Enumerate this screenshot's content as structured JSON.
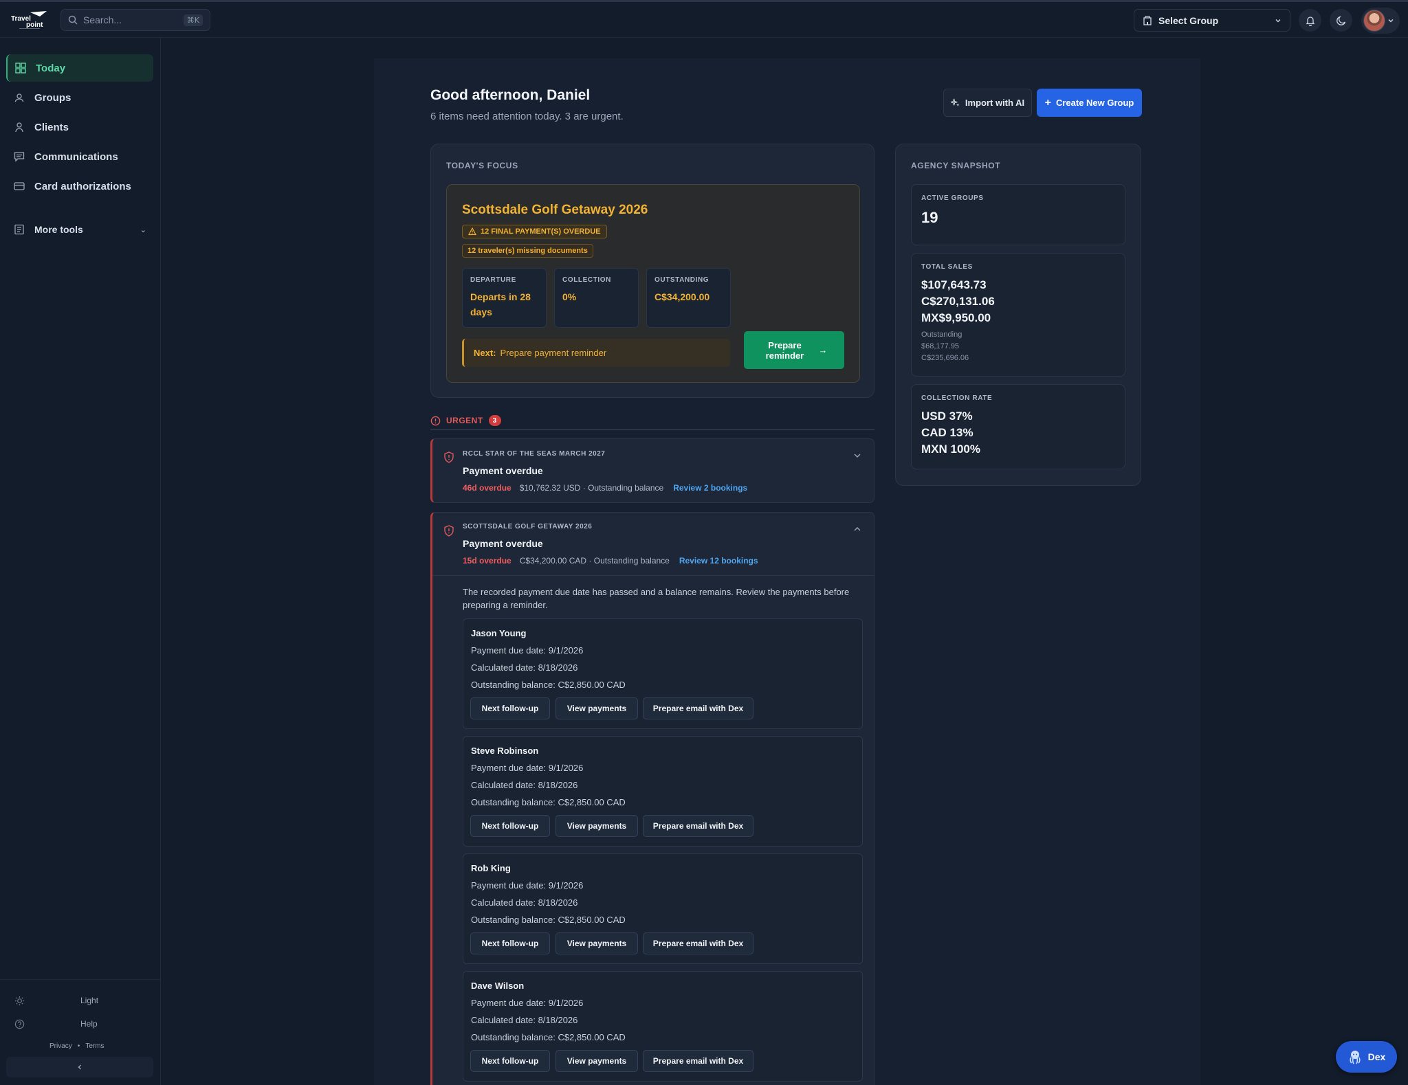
{
  "search": {
    "placeholder": "Search...",
    "shortcut": "⌘K"
  },
  "header": {
    "select_group": "Select Group"
  },
  "sidebar": {
    "items": [
      {
        "label": "Today"
      },
      {
        "label": "Groups"
      },
      {
        "label": "Clients"
      },
      {
        "label": "Communications"
      },
      {
        "label": "Card authorizations"
      },
      {
        "label": "More tools"
      }
    ],
    "theme": "Light",
    "help": "Help",
    "privacy": "Privacy",
    "terms": "Terms"
  },
  "greeting": {
    "title": "Good afternoon, Daniel",
    "subtitle": "6 items need attention today. 3 are urgent."
  },
  "actions": {
    "import": "Import with AI",
    "create": "Create New Group"
  },
  "focus": {
    "label": "TODAY'S FOCUS",
    "title": "Scottsdale Golf Getaway 2026",
    "badge_overdue": "12 FINAL PAYMENT(S) OVERDUE",
    "badge_docs": "12 traveler(s) missing documents",
    "departure_label": "DEPARTURE",
    "departure_value": "Departs in 28 days",
    "collection_label": "COLLECTION",
    "collection_value": "0%",
    "outstanding_label": "OUTSTANDING",
    "outstanding_value": "C$34,200.00",
    "next_label": "Next:",
    "next_value": "Prepare payment reminder",
    "prepare_btn": "Prepare reminder"
  },
  "snapshot": {
    "label": "AGENCY SNAPSHOT",
    "active_groups_label": "ACTIVE GROUPS",
    "active_groups_value": "19",
    "total_sales_label": "TOTAL SALES",
    "sales": [
      "$107,643.73",
      "C$270,131.06",
      "MX$9,950.00"
    ],
    "outstanding_label": "Outstanding",
    "outstanding": [
      "$68,177.95",
      "C$235,696.06"
    ],
    "collection_rate_label": "COLLECTION RATE",
    "rates": [
      "USD 37%",
      "CAD 13%",
      "MXN 100%"
    ]
  },
  "urgent": {
    "label": "URGENT",
    "count": "3",
    "items": [
      {
        "group": "RCCL STAR OF THE SEAS MARCH 2027",
        "title": "Payment overdue",
        "overdue": "46d overdue",
        "amount": "$10,762.32 USD · Outstanding balance",
        "review": "Review 2 bookings"
      },
      {
        "group": "SCOTTSDALE GOLF GETAWAY 2026",
        "title": "Payment overdue",
        "overdue": "15d overdue",
        "amount": "C$34,200.00 CAD · Outstanding balance",
        "review": "Review 12 bookings",
        "description": "The recorded payment due date has passed and a balance remains. Review the payments before preparing a reminder."
      }
    ]
  },
  "travelers": [
    {
      "name": "Jason Young",
      "due": "Payment due date: 9/1/2026",
      "calc": "Calculated date: 8/18/2026",
      "balance": "Outstanding balance: C$2,850.00 CAD"
    },
    {
      "name": "Steve Robinson",
      "due": "Payment due date: 9/1/2026",
      "calc": "Calculated date: 8/18/2026",
      "balance": "Outstanding balance: C$2,850.00 CAD"
    },
    {
      "name": "Rob King",
      "due": "Payment due date: 9/1/2026",
      "calc": "Calculated date: 8/18/2026",
      "balance": "Outstanding balance: C$2,850.00 CAD"
    },
    {
      "name": "Dave Wilson",
      "due": "Payment due date: 9/1/2026",
      "calc": "Calculated date: 8/18/2026",
      "balance": "Outstanding balance: C$2,850.00 CAD"
    }
  ],
  "traveler_actions": {
    "followup": "Next follow-up",
    "view": "View payments",
    "email": "Prepare email with Dex"
  },
  "dex": {
    "label": "Dex"
  },
  "colors": {
    "accent": "#2664e6",
    "success": "#10925e",
    "warning": "#f2b233",
    "danger": "#e25a5a",
    "background": "#131c2b"
  }
}
